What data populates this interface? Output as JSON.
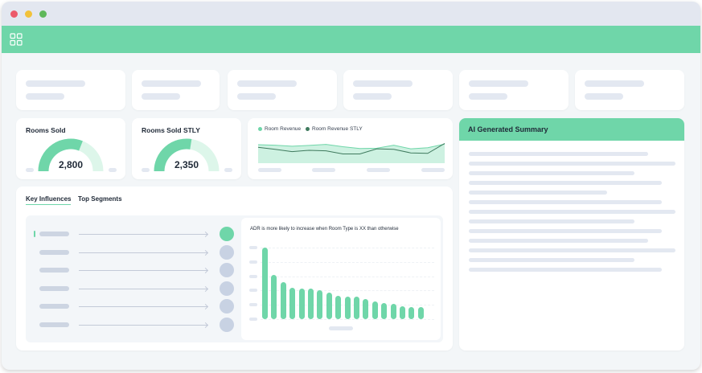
{
  "colors": {
    "accent": "#6fd6a9",
    "accent_dark": "#3f7a5e",
    "red_dot": "#ec5a6b",
    "yellow_dot": "#f2c23a",
    "green_dot": "#5fb85a",
    "skeleton": "#e3e8f1",
    "circle_inactive": "#c8d2e3",
    "gauge_track": "#ddf6ea"
  },
  "window": {
    "controls": [
      "close",
      "minimize",
      "maximize"
    ]
  },
  "appbar": {
    "icon": "grid-icon"
  },
  "kpi_cards": {
    "rooms_sold": {
      "title": "Rooms Sold",
      "value": "2,800",
      "fill_fraction": 0.62
    },
    "rooms_sold_stly": {
      "title": "Rooms Sold STLY",
      "value": "2,350",
      "fill_fraction": 0.55
    }
  },
  "revenue_chart": {
    "legend": [
      {
        "name": "Room Revenue",
        "color": "#6fd6a9"
      },
      {
        "name": "Room Revenue STLY",
        "color": "#3f7a5e"
      }
    ]
  },
  "tabs": [
    {
      "label": "Key Influences",
      "active": true
    },
    {
      "label": "Top Segments",
      "active": false
    }
  ],
  "influences": {
    "chart_title": "ADR is more likely to increase when Room Type is XX than otherwise",
    "items": [
      {
        "selected": true
      },
      {
        "selected": false
      },
      {
        "selected": false
      },
      {
        "selected": false
      },
      {
        "selected": false
      },
      {
        "selected": false
      }
    ]
  },
  "ai_summary": {
    "title": "AI Generated Summary"
  },
  "chart_data": [
    {
      "type": "area",
      "series": [
        {
          "name": "Room Revenue",
          "values": [
            0.72,
            0.7,
            0.66,
            0.69,
            0.73,
            0.64,
            0.57,
            0.58,
            0.7,
            0.56,
            0.6,
            0.74
          ]
        },
        {
          "name": "Room Revenue STLY",
          "values": [
            0.62,
            0.54,
            0.45,
            0.5,
            0.48,
            0.36,
            0.36,
            0.56,
            0.54,
            0.4,
            0.38,
            0.77
          ]
        }
      ],
      "ylim": [
        0,
        1
      ],
      "legend_position": "top-left"
    },
    {
      "type": "bar",
      "title": "ADR is more likely to increase when Room Type is XX than otherwise",
      "values": [
        100,
        62,
        52,
        44,
        43,
        43,
        40,
        37,
        33,
        31,
        31,
        28,
        25,
        23,
        21,
        18,
        17,
        17
      ],
      "ylim": [
        0,
        100
      ],
      "grid": true
    }
  ]
}
